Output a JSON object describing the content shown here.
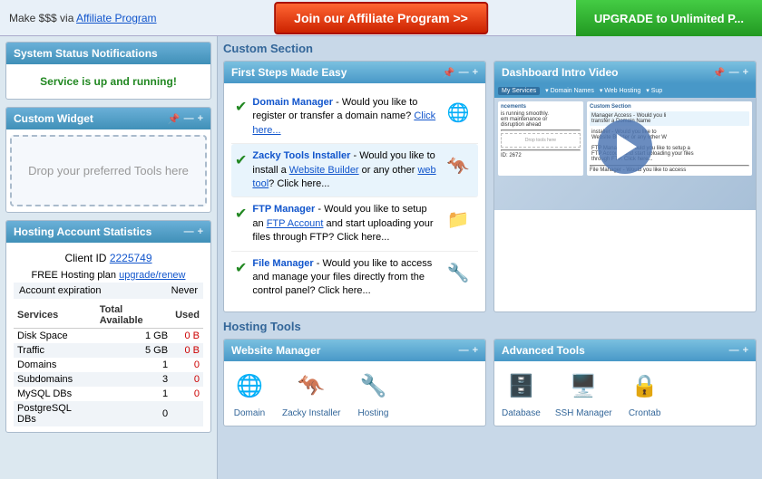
{
  "topbar": {
    "make_money_text": "Make $$$ via ",
    "affiliate_link": "Affiliate Program",
    "affiliate_btn": "Join our Affiliate Program >>",
    "upgrade_btn": "UPGRADE to Unlimited P..."
  },
  "sidebar": {
    "status_header": "System Status Notifications",
    "status_message": "Service is up and running!",
    "custom_widget_header": "Custom Widget",
    "drop_text": "Drop your preferred Tools here",
    "hosting_header": "Hosting Account Statistics",
    "client_label": "Client ID",
    "client_id": "2225749",
    "hosting_plan_text": "FREE Hosting plan ",
    "hosting_plan_link": "upgrade/renew",
    "account_exp_label": "Account expiration",
    "account_exp_value": "Never",
    "stats_cols": [
      "Services",
      "Total Available",
      "Used"
    ],
    "stats_rows": [
      {
        "service": "Disk Space",
        "available": "1 GB",
        "used": "0 B"
      },
      {
        "service": "Traffic",
        "available": "5 GB",
        "used": "0 B"
      },
      {
        "service": "Domains",
        "available": "1",
        "used": "0"
      },
      {
        "service": "Subdomains",
        "available": "3",
        "used": "0"
      },
      {
        "service": "MySQL DBs",
        "available": "1",
        "used": "0"
      },
      {
        "service": "PostgreSQL DBs",
        "available": "0",
        "used": ""
      }
    ]
  },
  "content": {
    "custom_section_label": "Custom Section",
    "first_steps_header": "First Steps Made Easy",
    "steps": [
      {
        "title": "Domain Manager",
        "desc": " - Would you like to register or transfer a domain name? Click here..."
      },
      {
        "title": "Zacky Tools Installer",
        "desc": " - Would you like to install a Website Builder or any other web tool? Click here..."
      },
      {
        "title": "FTP Manager",
        "desc": " - Would you like to setup an FTP Account and start uploading your files through FTP? Click here..."
      },
      {
        "title": "File Manager",
        "desc": " - Would you like to access and manage your files directly from the control panel? Click here..."
      }
    ],
    "dashboard_video_header": "Dashboard Intro Video",
    "hosting_tools_label": "Hosting Tools",
    "website_manager_header": "Website Manager",
    "website_manager_tools": [
      {
        "label": "Domain",
        "icon": "🌐"
      },
      {
        "label": "Zacky Installer",
        "icon": "🦘"
      },
      {
        "label": "Hosting",
        "icon": "🔧"
      }
    ],
    "advanced_tools_header": "Advanced Tools",
    "advanced_tools": [
      {
        "label": "Database",
        "icon": "🗄️"
      },
      {
        "label": "SSH Manager",
        "icon": "🖥️"
      },
      {
        "label": "Crontab",
        "icon": "🔒"
      }
    ]
  }
}
